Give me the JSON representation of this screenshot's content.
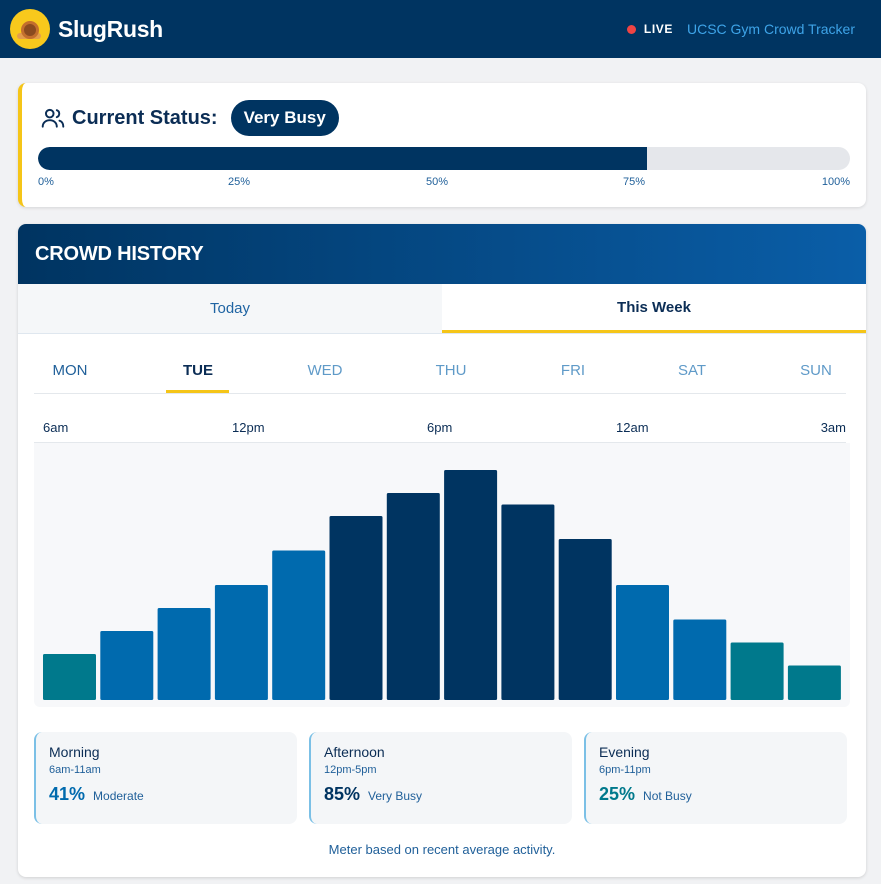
{
  "header": {
    "brand": "SlugRush",
    "live_label": "LIVE",
    "tracker_link": "UCSC Gym Crowd Tracker"
  },
  "status": {
    "label": "Current Status:",
    "level": "Very Busy",
    "progress_percent": 75,
    "scale_labels": [
      "0%",
      "25%",
      "50%",
      "75%",
      "100%"
    ]
  },
  "history": {
    "title": "CROWD HISTORY",
    "tabs": [
      {
        "label": "Today",
        "active": false
      },
      {
        "label": "This Week",
        "active": true
      }
    ],
    "days": [
      "MON",
      "TUE",
      "WED",
      "THU",
      "FRI",
      "SAT",
      "SUN"
    ],
    "selected_day": "TUE",
    "hour_labels": [
      "6am",
      "12pm",
      "6pm",
      "12am",
      "3am"
    ],
    "footnote": "Meter based on recent average activity."
  },
  "colors": {
    "low": "#00798c",
    "medium": "#006aae",
    "high": "#003461",
    "accent": "#f5c518"
  },
  "chart_data": {
    "type": "bar",
    "values": [
      20,
      30,
      40,
      50,
      65,
      80,
      90,
      100,
      85,
      70,
      50,
      35,
      25,
      15
    ],
    "levels": [
      "low",
      "medium",
      "medium",
      "medium",
      "medium",
      "high",
      "high",
      "high",
      "high",
      "high",
      "medium",
      "medium",
      "low",
      "low"
    ],
    "ylim": [
      0,
      100
    ]
  },
  "periods": [
    {
      "name": "Morning",
      "range": "6am-11am",
      "percent": "41%",
      "level": "Moderate",
      "color": "#006aae"
    },
    {
      "name": "Afternoon",
      "range": "12pm-5pm",
      "percent": "85%",
      "level": "Very Busy",
      "color": "#003461"
    },
    {
      "name": "Evening",
      "range": "6pm-11pm",
      "percent": "25%",
      "level": "Not Busy",
      "color": "#00798c"
    }
  ]
}
